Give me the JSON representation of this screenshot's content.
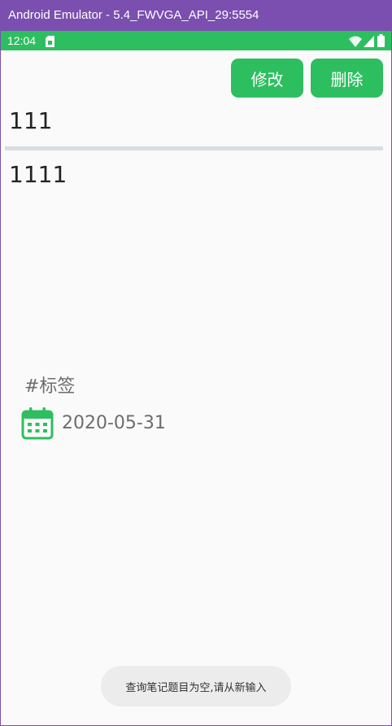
{
  "window": {
    "title": "Android Emulator - 5.4_FWVGA_API_29:5554"
  },
  "statusbar": {
    "time": "12:04"
  },
  "toolbar": {
    "edit_label": "修改",
    "delete_label": "删除"
  },
  "note": {
    "title": "111",
    "body": "1111",
    "tag": "#标签",
    "date": "2020-05-31"
  },
  "toast": {
    "message": "查询笔记题目为空,请从新输入"
  },
  "colors": {
    "accent": "#2dbe60",
    "window_frame": "#7a4faf",
    "background": "#fafafa",
    "divider": "#d8dde2",
    "meta_text": "#6d6d6d"
  },
  "icons": {
    "status_left": "sim-card-icon",
    "status_right": [
      "wifi-icon",
      "signal-icon",
      "battery-icon"
    ],
    "date": "calendar-icon"
  }
}
